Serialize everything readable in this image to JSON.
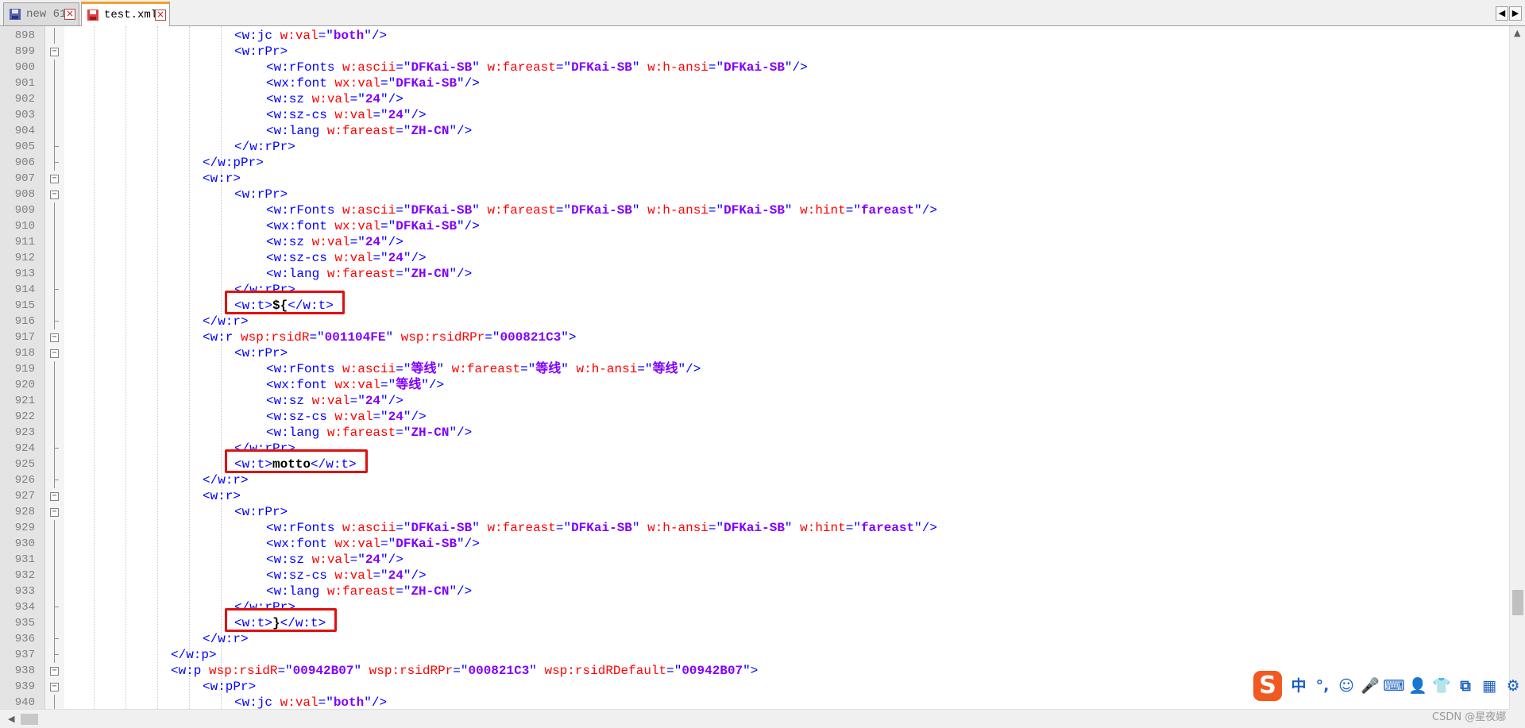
{
  "tabs": [
    {
      "label": "new 61",
      "active": false
    },
    {
      "label": "test.xml",
      "active": true
    }
  ],
  "tab_nav": {
    "prev": "◀",
    "next": "▶"
  },
  "colors": {
    "tag": "#0000ff",
    "attribute": "#ff0000",
    "value": "#8000ff",
    "text": "#000000",
    "highlight_box": "#e01010"
  },
  "lines": [
    {
      "n": "898",
      "fold": "line",
      "tokens": [
        [
          "t",
          "<w:jc "
        ],
        [
          "a",
          "w:val"
        ],
        [
          "t",
          "=\""
        ],
        [
          "v",
          "both"
        ],
        [
          "t",
          "\"/>"
        ]
      ]
    },
    {
      "n": "899",
      "fold": "box",
      "tokens": [
        [
          "t",
          "<w:rPr>"
        ]
      ]
    },
    {
      "n": "900",
      "fold": "line",
      "tokens": [
        [
          "t",
          "<w:rFonts "
        ],
        [
          "a",
          "w:ascii"
        ],
        [
          "t",
          "=\""
        ],
        [
          "v",
          "DFKai-SB"
        ],
        [
          "t",
          "\" "
        ],
        [
          "a",
          "w:fareast"
        ],
        [
          "t",
          "=\""
        ],
        [
          "v",
          "DFKai-SB"
        ],
        [
          "t",
          "\" "
        ],
        [
          "a",
          "w:h-ansi"
        ],
        [
          "t",
          "=\""
        ],
        [
          "v",
          "DFKai-SB"
        ],
        [
          "t",
          "\"/>"
        ]
      ]
    },
    {
      "n": "901",
      "fold": "line",
      "tokens": [
        [
          "t",
          "<wx:font "
        ],
        [
          "a",
          "wx:val"
        ],
        [
          "t",
          "=\""
        ],
        [
          "v",
          "DFKai-SB"
        ],
        [
          "t",
          "\"/>"
        ]
      ]
    },
    {
      "n": "902",
      "fold": "line",
      "tokens": [
        [
          "t",
          "<w:sz "
        ],
        [
          "a",
          "w:val"
        ],
        [
          "t",
          "=\""
        ],
        [
          "v",
          "24"
        ],
        [
          "t",
          "\"/>"
        ]
      ]
    },
    {
      "n": "903",
      "fold": "line",
      "tokens": [
        [
          "t",
          "<w:sz-cs "
        ],
        [
          "a",
          "w:val"
        ],
        [
          "t",
          "=\""
        ],
        [
          "v",
          "24"
        ],
        [
          "t",
          "\"/>"
        ]
      ]
    },
    {
      "n": "904",
      "fold": "line",
      "tokens": [
        [
          "t",
          "<w:lang "
        ],
        [
          "a",
          "w:fareast"
        ],
        [
          "t",
          "=\""
        ],
        [
          "v",
          "ZH-CN"
        ],
        [
          "t",
          "\"/>"
        ]
      ]
    },
    {
      "n": "905",
      "fold": "end",
      "tokens": [
        [
          "t",
          "</w:rPr>"
        ]
      ]
    },
    {
      "n": "906",
      "fold": "end",
      "tokens": [
        [
          "t",
          "</w:pPr>"
        ]
      ]
    },
    {
      "n": "907",
      "fold": "box",
      "tokens": [
        [
          "t",
          "<w:r>"
        ]
      ]
    },
    {
      "n": "908",
      "fold": "box",
      "tokens": [
        [
          "t",
          "<w:rPr>"
        ]
      ]
    },
    {
      "n": "909",
      "fold": "line",
      "tokens": [
        [
          "t",
          "<w:rFonts "
        ],
        [
          "a",
          "w:ascii"
        ],
        [
          "t",
          "=\""
        ],
        [
          "v",
          "DFKai-SB"
        ],
        [
          "t",
          "\" "
        ],
        [
          "a",
          "w:fareast"
        ],
        [
          "t",
          "=\""
        ],
        [
          "v",
          "DFKai-SB"
        ],
        [
          "t",
          "\" "
        ],
        [
          "a",
          "w:h-ansi"
        ],
        [
          "t",
          "=\""
        ],
        [
          "v",
          "DFKai-SB"
        ],
        [
          "t",
          "\" "
        ],
        [
          "a",
          "w:hint"
        ],
        [
          "t",
          "=\""
        ],
        [
          "v",
          "fareast"
        ],
        [
          "t",
          "\"/>"
        ]
      ]
    },
    {
      "n": "910",
      "fold": "line",
      "tokens": [
        [
          "t",
          "<wx:font "
        ],
        [
          "a",
          "wx:val"
        ],
        [
          "t",
          "=\""
        ],
        [
          "v",
          "DFKai-SB"
        ],
        [
          "t",
          "\"/>"
        ]
      ]
    },
    {
      "n": "911",
      "fold": "line",
      "tokens": [
        [
          "t",
          "<w:sz "
        ],
        [
          "a",
          "w:val"
        ],
        [
          "t",
          "=\""
        ],
        [
          "v",
          "24"
        ],
        [
          "t",
          "\"/>"
        ]
      ]
    },
    {
      "n": "912",
      "fold": "line",
      "tokens": [
        [
          "t",
          "<w:sz-cs "
        ],
        [
          "a",
          "w:val"
        ],
        [
          "t",
          "=\""
        ],
        [
          "v",
          "24"
        ],
        [
          "t",
          "\"/>"
        ]
      ]
    },
    {
      "n": "913",
      "fold": "line",
      "tokens": [
        [
          "t",
          "<w:lang "
        ],
        [
          "a",
          "w:fareast"
        ],
        [
          "t",
          "=\""
        ],
        [
          "v",
          "ZH-CN"
        ],
        [
          "t",
          "\"/>"
        ]
      ]
    },
    {
      "n": "914",
      "fold": "end",
      "tokens": [
        [
          "t",
          "</w:rPr>"
        ]
      ]
    },
    {
      "n": "915",
      "fold": "line",
      "tokens": [
        [
          "t",
          "<w:t>"
        ],
        [
          "x",
          "${"
        ],
        [
          "t",
          "</w:t>"
        ]
      ],
      "highlight": true
    },
    {
      "n": "916",
      "fold": "end",
      "tokens": [
        [
          "t",
          "</w:r>"
        ]
      ]
    },
    {
      "n": "917",
      "fold": "box",
      "tokens": [
        [
          "t",
          "<w:r "
        ],
        [
          "a",
          "wsp:rsidR"
        ],
        [
          "t",
          "=\""
        ],
        [
          "v",
          "001104FE"
        ],
        [
          "t",
          "\" "
        ],
        [
          "a",
          "wsp:rsidRPr"
        ],
        [
          "t",
          "=\""
        ],
        [
          "v",
          "000821C3"
        ],
        [
          "t",
          "\">"
        ]
      ]
    },
    {
      "n": "918",
      "fold": "box",
      "tokens": [
        [
          "t",
          "<w:rPr>"
        ]
      ]
    },
    {
      "n": "919",
      "fold": "line",
      "tokens": [
        [
          "t",
          "<w:rFonts "
        ],
        [
          "a",
          "w:ascii"
        ],
        [
          "t",
          "=\""
        ],
        [
          "v",
          "等线"
        ],
        [
          "t",
          "\" "
        ],
        [
          "a",
          "w:fareast"
        ],
        [
          "t",
          "=\""
        ],
        [
          "v",
          "等线"
        ],
        [
          "t",
          "\" "
        ],
        [
          "a",
          "w:h-ansi"
        ],
        [
          "t",
          "=\""
        ],
        [
          "v",
          "等线"
        ],
        [
          "t",
          "\"/>"
        ]
      ]
    },
    {
      "n": "920",
      "fold": "line",
      "tokens": [
        [
          "t",
          "<wx:font "
        ],
        [
          "a",
          "wx:val"
        ],
        [
          "t",
          "=\""
        ],
        [
          "v",
          "等线"
        ],
        [
          "t",
          "\"/>"
        ]
      ]
    },
    {
      "n": "921",
      "fold": "line",
      "tokens": [
        [
          "t",
          "<w:sz "
        ],
        [
          "a",
          "w:val"
        ],
        [
          "t",
          "=\""
        ],
        [
          "v",
          "24"
        ],
        [
          "t",
          "\"/>"
        ]
      ]
    },
    {
      "n": "922",
      "fold": "line",
      "tokens": [
        [
          "t",
          "<w:sz-cs "
        ],
        [
          "a",
          "w:val"
        ],
        [
          "t",
          "=\""
        ],
        [
          "v",
          "24"
        ],
        [
          "t",
          "\"/>"
        ]
      ]
    },
    {
      "n": "923",
      "fold": "line",
      "tokens": [
        [
          "t",
          "<w:lang "
        ],
        [
          "a",
          "w:fareast"
        ],
        [
          "t",
          "=\""
        ],
        [
          "v",
          "ZH-CN"
        ],
        [
          "t",
          "\"/>"
        ]
      ]
    },
    {
      "n": "924",
      "fold": "end",
      "tokens": [
        [
          "t",
          "</w:rPr>"
        ]
      ]
    },
    {
      "n": "925",
      "fold": "line",
      "tokens": [
        [
          "t",
          "<w:t>"
        ],
        [
          "x",
          "motto"
        ],
        [
          "t",
          "</w:t>"
        ]
      ],
      "highlight": true
    },
    {
      "n": "926",
      "fold": "end",
      "tokens": [
        [
          "t",
          "</w:r>"
        ]
      ]
    },
    {
      "n": "927",
      "fold": "box",
      "tokens": [
        [
          "t",
          "<w:r>"
        ]
      ]
    },
    {
      "n": "928",
      "fold": "box",
      "tokens": [
        [
          "t",
          "<w:rPr>"
        ]
      ]
    },
    {
      "n": "929",
      "fold": "line",
      "tokens": [
        [
          "t",
          "<w:rFonts "
        ],
        [
          "a",
          "w:ascii"
        ],
        [
          "t",
          "=\""
        ],
        [
          "v",
          "DFKai-SB"
        ],
        [
          "t",
          "\" "
        ],
        [
          "a",
          "w:fareast"
        ],
        [
          "t",
          "=\""
        ],
        [
          "v",
          "DFKai-SB"
        ],
        [
          "t",
          "\" "
        ],
        [
          "a",
          "w:h-ansi"
        ],
        [
          "t",
          "=\""
        ],
        [
          "v",
          "DFKai-SB"
        ],
        [
          "t",
          "\" "
        ],
        [
          "a",
          "w:hint"
        ],
        [
          "t",
          "=\""
        ],
        [
          "v",
          "fareast"
        ],
        [
          "t",
          "\"/>"
        ]
      ]
    },
    {
      "n": "930",
      "fold": "line",
      "tokens": [
        [
          "t",
          "<wx:font "
        ],
        [
          "a",
          "wx:val"
        ],
        [
          "t",
          "=\""
        ],
        [
          "v",
          "DFKai-SB"
        ],
        [
          "t",
          "\"/>"
        ]
      ]
    },
    {
      "n": "931",
      "fold": "line",
      "tokens": [
        [
          "t",
          "<w:sz "
        ],
        [
          "a",
          "w:val"
        ],
        [
          "t",
          "=\""
        ],
        [
          "v",
          "24"
        ],
        [
          "t",
          "\"/>"
        ]
      ]
    },
    {
      "n": "932",
      "fold": "line",
      "tokens": [
        [
          "t",
          "<w:sz-cs "
        ],
        [
          "a",
          "w:val"
        ],
        [
          "t",
          "=\""
        ],
        [
          "v",
          "24"
        ],
        [
          "t",
          "\"/>"
        ]
      ]
    },
    {
      "n": "933",
      "fold": "line",
      "tokens": [
        [
          "t",
          "<w:lang "
        ],
        [
          "a",
          "w:fareast"
        ],
        [
          "t",
          "=\""
        ],
        [
          "v",
          "ZH-CN"
        ],
        [
          "t",
          "\"/>"
        ]
      ]
    },
    {
      "n": "934",
      "fold": "end",
      "tokens": [
        [
          "t",
          "</w:rPr>"
        ]
      ]
    },
    {
      "n": "935",
      "fold": "line",
      "tokens": [
        [
          "t",
          "<w:t>"
        ],
        [
          "x",
          "}"
        ],
        [
          "t",
          "</w:t>"
        ]
      ],
      "highlight": true
    },
    {
      "n": "936",
      "fold": "end",
      "tokens": [
        [
          "t",
          "</w:r>"
        ]
      ]
    },
    {
      "n": "937",
      "fold": "end",
      "tokens": [
        [
          "t",
          "</w:p>"
        ]
      ]
    },
    {
      "n": "938",
      "fold": "box",
      "tokens": [
        [
          "t",
          "<w:p "
        ],
        [
          "a",
          "wsp:rsidR"
        ],
        [
          "t",
          "=\""
        ],
        [
          "v",
          "00942B07"
        ],
        [
          "t",
          "\" "
        ],
        [
          "a",
          "wsp:rsidRPr"
        ],
        [
          "t",
          "=\""
        ],
        [
          "v",
          "000821C3"
        ],
        [
          "t",
          "\" "
        ],
        [
          "a",
          "wsp:rsidRDefault"
        ],
        [
          "t",
          "=\""
        ],
        [
          "v",
          "00942B07"
        ],
        [
          "t",
          "\">"
        ]
      ]
    },
    {
      "n": "939",
      "fold": "box",
      "tokens": [
        [
          "t",
          "<w:pPr>"
        ]
      ]
    },
    {
      "n": "940",
      "fold": "line",
      "tokens": [
        [
          "t",
          "<w:jc "
        ],
        [
          "a",
          "w:val"
        ],
        [
          "t",
          "=\""
        ],
        [
          "v",
          "both"
        ],
        [
          "t",
          "\"/>"
        ]
      ]
    }
  ],
  "ime_toolbar": {
    "logo": "S",
    "buttons": [
      {
        "icon": "chinese-mode-icon",
        "glyph": "中"
      },
      {
        "icon": "punctuation-icon",
        "glyph": "°,"
      },
      {
        "icon": "emoji-icon",
        "glyph": "☺"
      },
      {
        "icon": "microphone-icon",
        "glyph": "🎤"
      },
      {
        "icon": "keyboard-icon",
        "glyph": "⌨"
      },
      {
        "icon": "user-icon",
        "glyph": "👤"
      },
      {
        "icon": "skin-icon",
        "glyph": "👕"
      },
      {
        "icon": "toolbox-icon",
        "glyph": "⧉"
      },
      {
        "icon": "apps-icon",
        "glyph": "▦"
      },
      {
        "icon": "settings-icon",
        "glyph": "⚙"
      }
    ]
  },
  "watermark": "CSDN @星夜娜"
}
